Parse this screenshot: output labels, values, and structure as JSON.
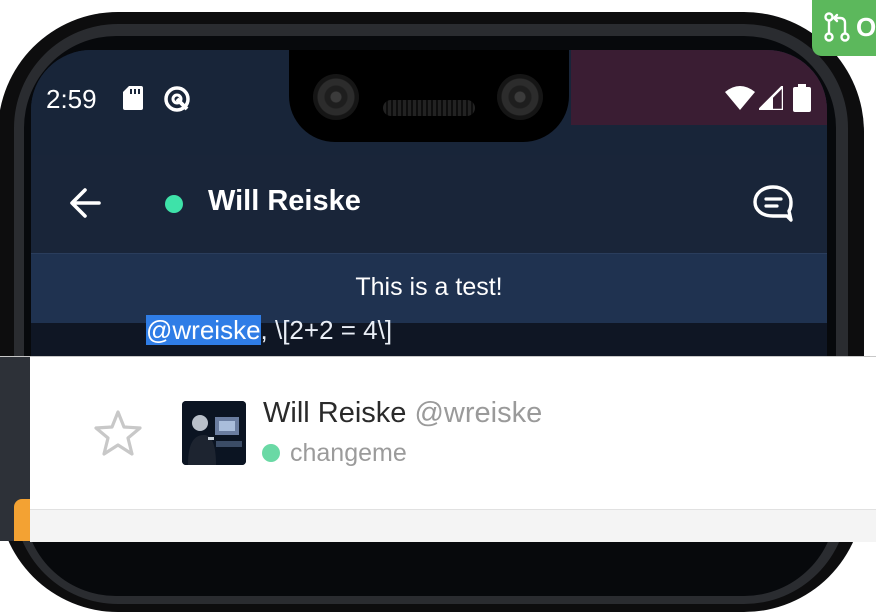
{
  "statusbar": {
    "time": "2:59",
    "icons": [
      "sd-card-icon",
      "sync-icon",
      "wifi-icon",
      "cell-signal-icon",
      "battery-icon"
    ]
  },
  "appbar": {
    "title": "Will Reiske",
    "presence_color": "#3ee2a9",
    "icons": [
      "arrow-back-icon",
      "chat-bubble-icon"
    ]
  },
  "banner": {
    "text": "This is a test!"
  },
  "message": {
    "mention": "@wreiske",
    "text": ", \\[2+2 = 4\\]"
  },
  "profile": {
    "name": "Will Reiske",
    "handle": "@wreiske",
    "status": "changeme",
    "status_color": "#6ad9a5",
    "icons": [
      "star-icon",
      "avatar"
    ]
  },
  "pr_badge": {
    "label": "O",
    "color": "#5cb85c",
    "icon": "pull-request-icon"
  }
}
